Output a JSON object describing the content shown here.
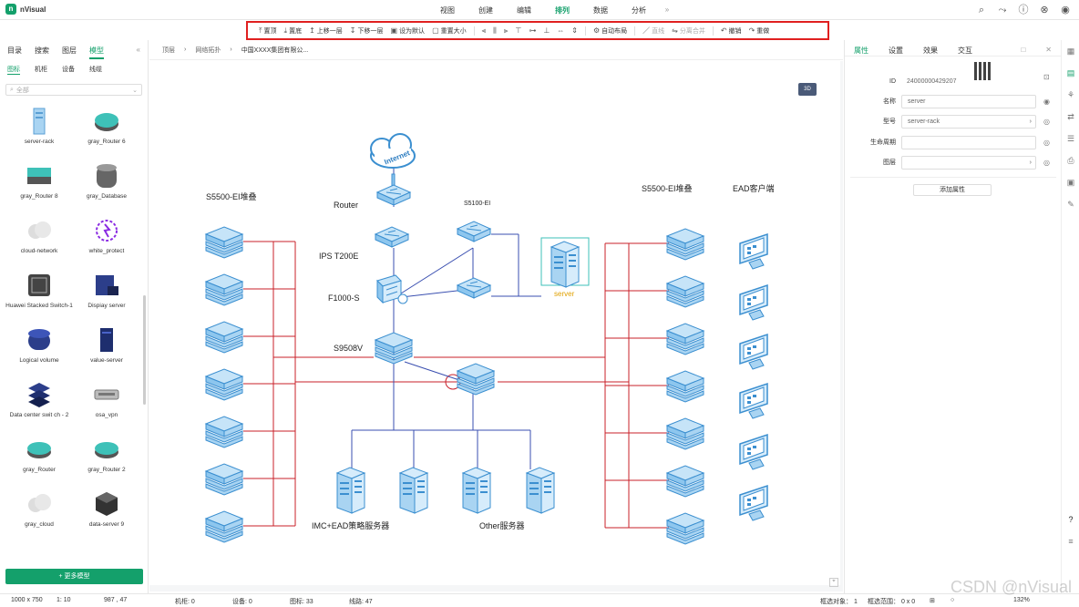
{
  "app": {
    "name": "nVisual"
  },
  "menu": [
    "视图",
    "创建",
    "编辑",
    "排列",
    "数据",
    "分析"
  ],
  "menu_more": "»",
  "top_icons": [
    "search-icon",
    "share-icon",
    "info-icon",
    "settings-icon",
    "user-icon"
  ],
  "toolbar": [
    {
      "label": "置顶",
      "icon": "⤒"
    },
    {
      "label": "置底",
      "icon": "⤓"
    },
    {
      "label": "上移一层",
      "icon": "↥"
    },
    {
      "label": "下移一层",
      "icon": "↧"
    },
    {
      "label": "设为默认",
      "icon": "▣"
    },
    {
      "label": "重置大小",
      "icon": "▢"
    },
    {
      "label": "自动布局",
      "icon": "⚙"
    },
    {
      "label": "直线",
      "icon": "／"
    },
    {
      "label": "分离合并",
      "icon": "⇋"
    },
    {
      "label": "撤销",
      "icon": "↶"
    },
    {
      "label": "重做",
      "icon": "↷"
    }
  ],
  "left": {
    "tabs": [
      "目录",
      "搜索",
      "图层",
      "模型"
    ],
    "collapse": "«",
    "subtabs": [
      "图标",
      "机柜",
      "设备",
      "线缆"
    ],
    "search_placeholder": "全部",
    "items": [
      "server-rack",
      "gray_Router 6",
      "gray_Router 8",
      "gray_Database",
      "cloud-network",
      "white_protect",
      "Huawei Stacked Switch-1",
      "Dispiay server",
      "Logical volume",
      "value-server",
      "Data center swit ch - 2",
      "osa_vpn",
      "gray_Router",
      "gray_Router 2",
      "gray_cloud",
      "data-server 9"
    ],
    "more_button": "+ 更多模型"
  },
  "breadcrumb": [
    "顶层",
    "网络拓扑",
    "中国XXXX集团有限公..."
  ],
  "canvas": {
    "btn3d": "3D",
    "labels": {
      "internet": "Internet",
      "router": "Router",
      "ips": "IPS T200E",
      "f1000": "F1000-S",
      "s9508": "S9508V",
      "s5100": "S5100-EI",
      "server": "server",
      "left_stack": "S5500-EI堆叠",
      "right_stack": "S5500-EI堆叠",
      "ead_client": "EAD客户端",
      "imc": "IMC+EAD策略服务器",
      "other": "Other服务器"
    }
  },
  "right": {
    "tabs": [
      "属性",
      "设置",
      "效果",
      "交互"
    ],
    "id_label": "ID",
    "id_value": "24000000429207",
    "name_label": "名称",
    "name_value": "server",
    "model_label": "型号",
    "model_value": "server-rack",
    "lifecycle_label": "生命周期",
    "lifecycle_value": "",
    "layer_label": "图层",
    "layer_value": "",
    "add_attr": "添加属性"
  },
  "status": {
    "size": "1000 x 750",
    "scale": "1: 10",
    "coords": "987 , 47",
    "racks": "机柜: 0",
    "devices": "设备: 0",
    "icons": "图标: 33",
    "lines": "线路: 47",
    "selected": "框选对象： 1",
    "range": "框选范围： 0 x 0",
    "zoom": "132%"
  },
  "watermark": "CSDN @nVisual",
  "colors": {
    "accent": "#14a06b",
    "red_line": "#c8202a",
    "blue_line": "#3a4fb0",
    "device": "#6fb7e8"
  }
}
